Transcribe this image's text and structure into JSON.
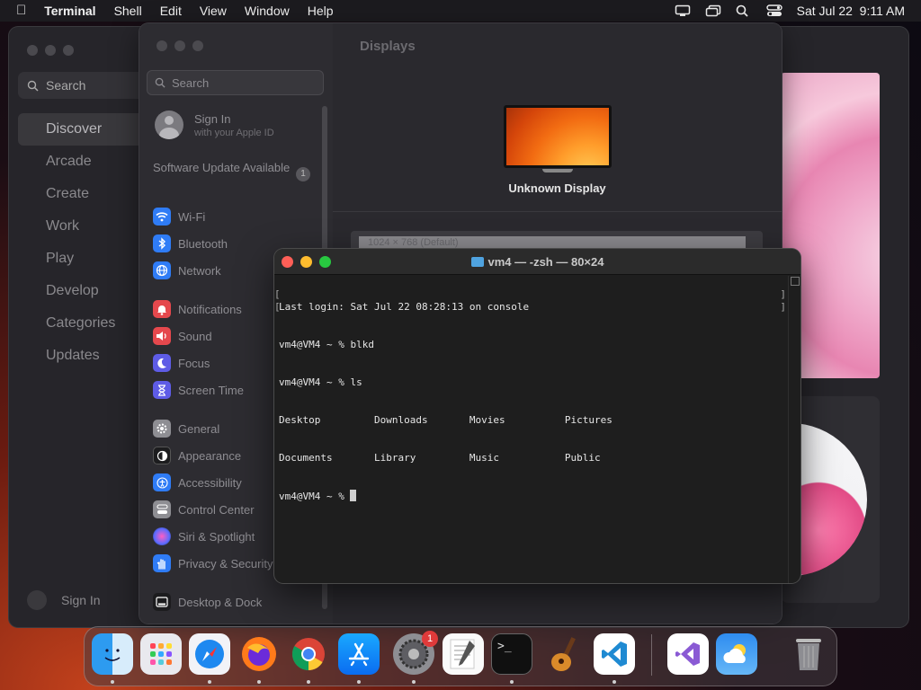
{
  "menubar": {
    "app_name": "Terminal",
    "menus": [
      "Shell",
      "Edit",
      "View",
      "Window",
      "Help"
    ],
    "datetime": "Sat Jul 22  9:11 AM"
  },
  "appstore": {
    "search_placeholder": "Search",
    "nav": [
      "Discover",
      "Arcade",
      "Create",
      "Work",
      "Play",
      "Develop",
      "Categories",
      "Updates"
    ],
    "selected": "Discover",
    "sign_in": "Sign In"
  },
  "settings": {
    "search_placeholder": "Search",
    "apple_id_title": "Sign In",
    "apple_id_subtitle": "with your Apple ID",
    "software_update": "Software Update Available",
    "software_update_count": "1",
    "items": [
      {
        "label": "Wi-Fi",
        "icon": "wifi-icon",
        "color": "#2f7cf6"
      },
      {
        "label": "Bluetooth",
        "icon": "bluetooth-icon",
        "color": "#2f7cf6"
      },
      {
        "label": "Network",
        "icon": "globe-icon",
        "color": "#2f7cf6"
      },
      {
        "label": "Notifications",
        "icon": "bell-icon",
        "color": "#e5484d"
      },
      {
        "label": "Sound",
        "icon": "speaker-icon",
        "color": "#e5484d"
      },
      {
        "label": "Focus",
        "icon": "moon-icon",
        "color": "#5e5ce6"
      },
      {
        "label": "Screen Time",
        "icon": "hourglass-icon",
        "color": "#5e5ce6"
      },
      {
        "label": "General",
        "icon": "gear-icon",
        "color": "#8e8e93"
      },
      {
        "label": "Appearance",
        "icon": "appearance-icon",
        "color": "#1c1c1e"
      },
      {
        "label": "Accessibility",
        "icon": "accessibility-icon",
        "color": "#2f7cf6"
      },
      {
        "label": "Control Center",
        "icon": "control-center-icon",
        "color": "#8e8e93"
      },
      {
        "label": "Siri & Spotlight",
        "icon": "siri-icon",
        "color": "#c03ce6"
      },
      {
        "label": "Privacy & Security",
        "icon": "hand-icon",
        "color": "#2f7cf6"
      },
      {
        "label": "Desktop & Dock",
        "icon": "dock-icon",
        "color": "#1c1c1e"
      }
    ],
    "pane_title": "Displays",
    "display_name": "Unknown Display",
    "resolution": "1024 × 768 (Default)"
  },
  "terminal": {
    "title": "vm4 — -zsh — 80×24",
    "lines": [
      "Last login: Sat Jul 22 08:28:13 on console",
      "vm4@VM4 ~ % blkd",
      "vm4@VM4 ~ % ls",
      "Desktop         Downloads       Movies          Pictures",
      "Documents       Library         Music           Public",
      "vm4@VM4 ~ % "
    ]
  },
  "dock": {
    "apps": [
      "Finder",
      "Launchpad",
      "Safari",
      "Firefox",
      "Chrome",
      "App Store",
      "System Settings",
      "TextEdit",
      "Terminal",
      "GarageBand",
      "Visual Studio Code",
      "Visual Studio",
      "Weather",
      "Trash"
    ],
    "settings_badge": "1"
  }
}
